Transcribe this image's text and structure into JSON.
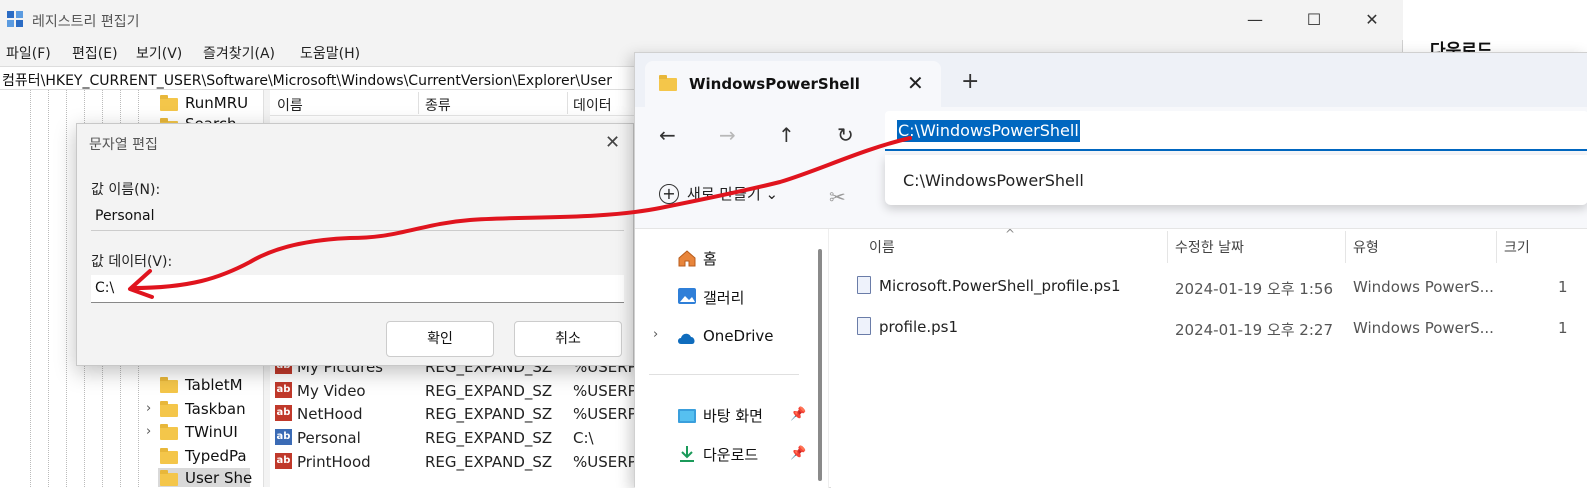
{
  "registry": {
    "title": "레지스트리 편집기",
    "menu": [
      "파일(F)",
      "편집(E)",
      "보기(V)",
      "즐겨찾기(A)",
      "도움말(H)"
    ],
    "address": "컴퓨터\\HKEY_CURRENT_USER\\Software\\Microsoft\\Windows\\CurrentVersion\\Explorer\\User",
    "tree_items": [
      "RunMRU",
      "Search",
      "TabletM",
      "Taskban",
      "TWinUI",
      "TypedPa",
      "User She"
    ],
    "columns": [
      "이름",
      "종류",
      "데이터"
    ],
    "rows": [
      {
        "name": "My Pictures",
        "type": "REG_EXPAND_SZ",
        "data": "%USERPF"
      },
      {
        "name": "My Video",
        "type": "REG_EXPAND_SZ",
        "data": "%USERPF"
      },
      {
        "name": "NetHood",
        "type": "REG_EXPAND_SZ",
        "data": "%USERPF"
      },
      {
        "name": "Personal",
        "type": "REG_EXPAND_SZ",
        "data": "C:\\"
      },
      {
        "name": "PrintHood",
        "type": "REG_EXPAND_SZ",
        "data": "%USERPF"
      }
    ]
  },
  "dialog": {
    "title": "문자열 편집",
    "name_label": "값 이름(N):",
    "name_value": "Personal",
    "data_label": "값 데이터(V):",
    "data_value": "C:\\",
    "ok": "확인",
    "cancel": "취소"
  },
  "explorer": {
    "tab_title": "WindowsPowerShell",
    "address": "C:\\WindowsPowerShell",
    "suggestion": "C:\\WindowsPowerShell",
    "new_label": "새로 만들기",
    "nav": [
      "홈",
      "갤러리",
      "OneDrive",
      "바탕 화면",
      "다운로드"
    ],
    "columns": [
      "이름",
      "수정한 날짜",
      "유형",
      "크기"
    ],
    "files": [
      {
        "name": "Microsoft.PowerShell_profile.ps1",
        "date": "2024-01-19 오후 1:56",
        "type": "Windows PowerS...",
        "size": "1"
      },
      {
        "name": "profile.ps1",
        "date": "2024-01-19 오후 2:27",
        "type": "Windows PowerS...",
        "size": "1"
      }
    ]
  },
  "background": {
    "downloads_label": "다운로드"
  },
  "colors": {
    "accent": "#0067c0",
    "annotation": "#e0141e",
    "folder": "#f4c64a"
  }
}
